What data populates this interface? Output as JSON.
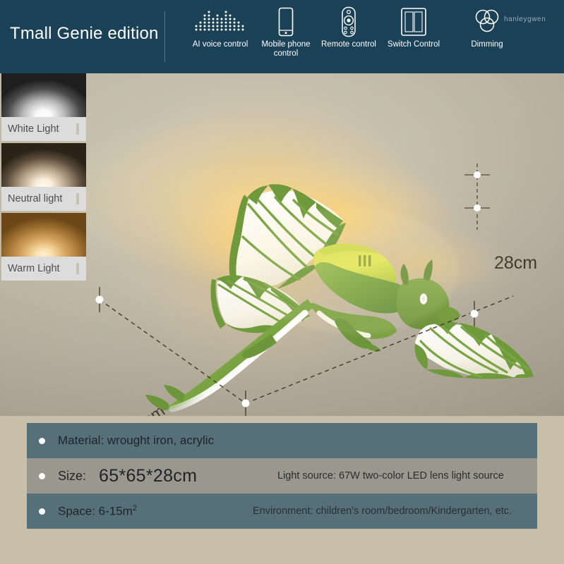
{
  "header": {
    "title": "Tmall Genie edition",
    "watermark": "hanleygwen",
    "bg_color": "#1b4157",
    "features": [
      {
        "label": "AI voice control",
        "icon": "voice-dotmatrix-icon"
      },
      {
        "label": "Mobile phone\ncontrol",
        "icon": "mobile-phone-icon"
      },
      {
        "label": "Remote control",
        "icon": "remote-control-icon"
      },
      {
        "label": "Switch Control",
        "icon": "wall-switch-icon"
      },
      {
        "label": "Dimming",
        "icon": "dimming-circles-icon"
      }
    ]
  },
  "light_modes": [
    {
      "label": "White Light",
      "swatch": "white"
    },
    {
      "label": "Neutral light",
      "swatch": "neutral"
    },
    {
      "label": "Warm Light",
      "swatch": "warm"
    }
  ],
  "product": {
    "name": "dragon-ceiling-lamp",
    "body_color": "#7aa24a",
    "accent_color": "#e8e24a",
    "glow_color": "#ffcd69"
  },
  "dimensions": {
    "height": "28cm",
    "width": "65cm",
    "depth": "65cm"
  },
  "specs": {
    "rows": [
      {
        "label": "Material: wrought iron, acrylic",
        "style": "a"
      },
      {
        "label": "Size:",
        "value": "65*65*28cm",
        "sub": "Light source:  67W two-color LED lens light source",
        "style": "b"
      },
      {
        "label": "Space: 6-15m",
        "superscript": "2",
        "sub": "Environment: children's room/bedroom/Kindergarten, etc.",
        "style": "a"
      }
    ]
  }
}
